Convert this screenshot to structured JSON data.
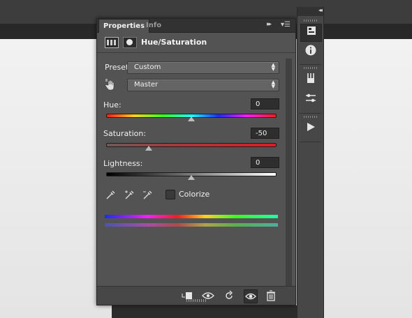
{
  "panel": {
    "tabs": [
      {
        "label": "Properties",
        "active": true
      },
      {
        "label": "Info",
        "active": false
      }
    ],
    "collapse_glyph": "▸▸",
    "menu_glyph": "▾☰",
    "header": {
      "adjustment_icon": "hue-saturation-layer-icon",
      "mask_icon": "layer-mask-icon",
      "title": "Hue/Saturation"
    },
    "preset": {
      "label": "Preset:",
      "value": "Custom"
    },
    "channel": {
      "value": "Master",
      "tool_icon": "on-image-adjustment-hand-icon"
    },
    "hue": {
      "label": "Hue:",
      "value": "0",
      "slider_fraction": 0.5
    },
    "saturation": {
      "label": "Saturation:",
      "value": "-50",
      "slider_fraction": 0.25
    },
    "lightness": {
      "label": "Lightness:",
      "value": "0",
      "slider_fraction": 0.5
    },
    "eyedroppers": [
      "eyedropper-icon",
      "eyedropper-plus-icon",
      "eyedropper-minus-icon"
    ],
    "colorize": {
      "label": "Colorize",
      "checked": false
    },
    "footer_buttons": [
      "clip-to-layer-icon",
      "view-previous-state-icon",
      "reset-icon",
      "visibility-eye-icon",
      "trash-icon"
    ],
    "colors": {
      "panel_bg": "#535353",
      "tab_bar": "#323232",
      "field_bg": "#2e2e2e",
      "saturation_track": "#c8282d"
    }
  },
  "dock": {
    "collapse_glyph": "◂◂",
    "buttons": [
      {
        "icon": "properties-panel-icon",
        "active": true
      },
      {
        "icon": "info-panel-icon",
        "active": false
      },
      {
        "icon": "brushes-panel-icon",
        "active": false
      },
      {
        "icon": "adjustments-panel-icon",
        "active": false
      },
      {
        "icon": "actions-play-icon",
        "active": false
      }
    ]
  }
}
